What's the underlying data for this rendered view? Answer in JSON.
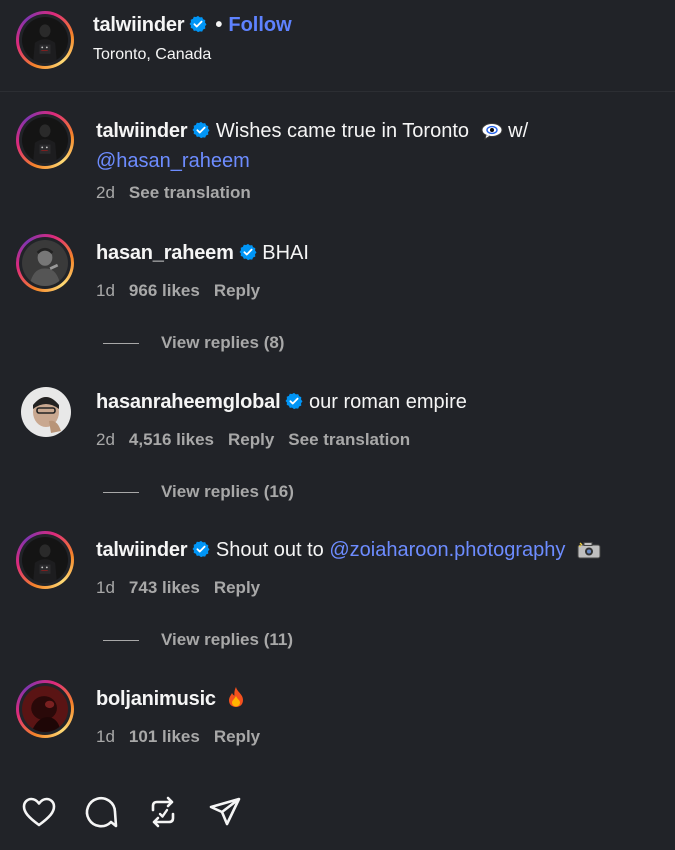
{
  "header": {
    "username": "talwiinder",
    "follow_label": "Follow",
    "separator": "•",
    "location": "Toronto, Canada"
  },
  "comments": [
    {
      "username": "talwiinder",
      "verified": true,
      "text": "Wishes came true in Toronto",
      "emoji": "eye-in-speech-bubble-emoji",
      "text_after": "w/",
      "mention": "@hasan_raheem",
      "time": "2d",
      "actions": [
        "See translation"
      ]
    },
    {
      "username": "hasan_raheem",
      "verified": true,
      "text": "BHAI",
      "time": "1d",
      "likes": "966 likes",
      "actions": [
        "Reply"
      ],
      "view_replies": "View replies (8)"
    },
    {
      "username": "hasanraheemglobal",
      "verified": true,
      "text": "our roman empire",
      "time": "2d",
      "likes": "4,516 likes",
      "actions": [
        "Reply",
        "See translation"
      ],
      "view_replies": "View replies (16)"
    },
    {
      "username": "talwiinder",
      "verified": true,
      "text": "Shout out to",
      "mention": "@zoiaharoon.photography",
      "emoji": "camera-with-flash-emoji",
      "time": "1d",
      "likes": "743 likes",
      "actions": [
        "Reply"
      ],
      "view_replies": "View replies (11)"
    },
    {
      "username": "boljanimusic",
      "verified": false,
      "emoji": "fire-emoji",
      "time": "1d",
      "likes": "101 likes",
      "actions": [
        "Reply"
      ]
    }
  ],
  "action_bar": {
    "icons": [
      "heart-icon",
      "comment-icon",
      "repost-icon",
      "share-icon"
    ]
  },
  "colors": {
    "background": "#212328",
    "link": "#5e82ff",
    "verified": "#0095f6",
    "muted": "#a8a8a8"
  }
}
